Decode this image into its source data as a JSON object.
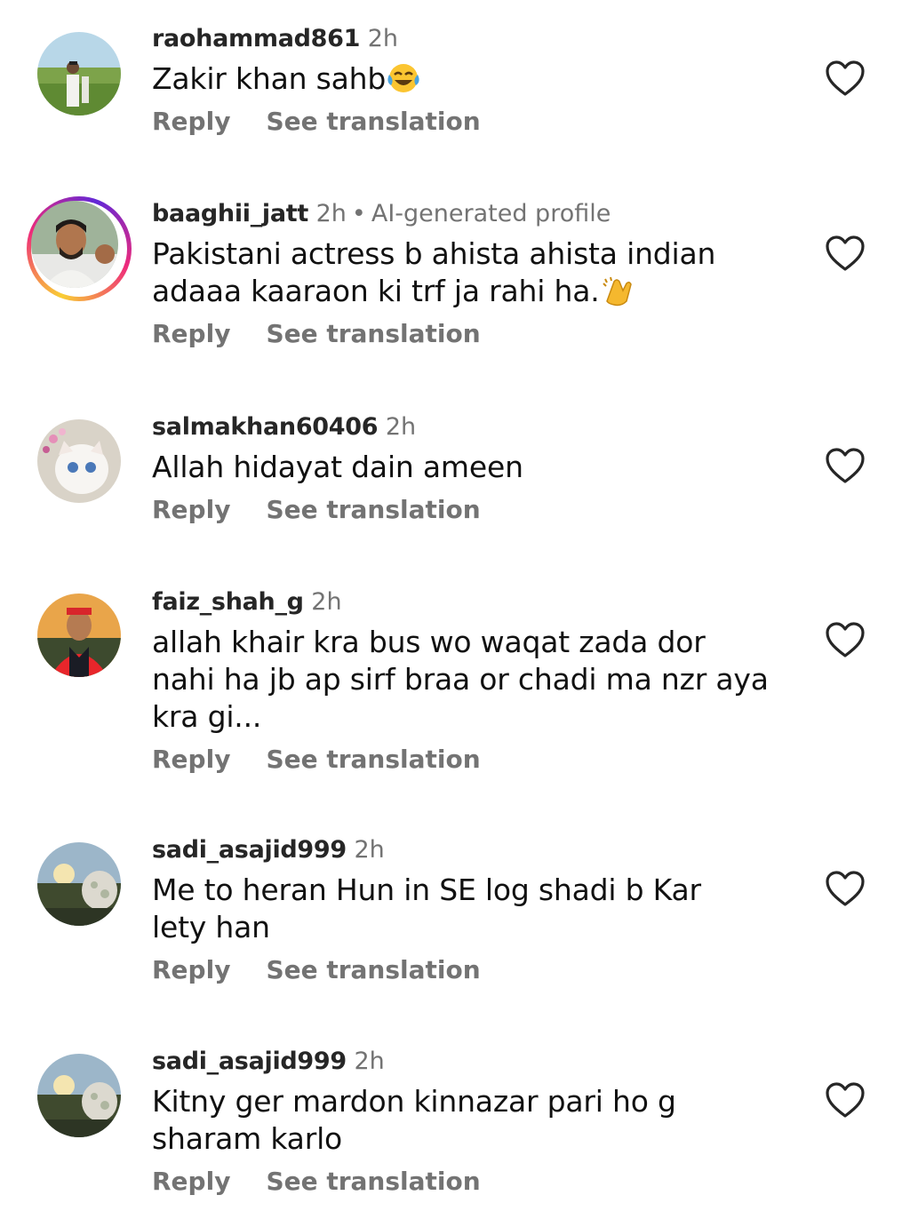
{
  "reply_label": "Reply",
  "translate_label": "See translation",
  "comments": [
    {
      "username": "raohammad861",
      "time": "2h",
      "text": "Zakir khan sahb",
      "emoji": "face-with-tears-of-joy"
    },
    {
      "username": "baaghii_jatt",
      "time": "2h",
      "dot": "•",
      "badge": "AI-generated profile",
      "text_line1": "Pakistani actress b ahista ahista indian",
      "text_line2": "adaaa kaaraon ki trf ja rahi ha.",
      "emoji": "clapping-hands"
    },
    {
      "username": "salmakhan60406",
      "time": "2h",
      "text": "Allah hidayat dain ameen"
    },
    {
      "username": "faiz_shah_g",
      "time": "2h",
      "text_line1": "allah khair kra bus wo waqat zada dor",
      "text_line2": "nahi ha jb ap sirf braa or chadi ma nzr aya",
      "text_line3": "kra gi..."
    },
    {
      "username": "sadi_asajid999",
      "time": "2h",
      "text_line1": "Me to heran Hun in SE log shadi b Kar",
      "text_line2": "lety han"
    },
    {
      "username": "sadi_asajid999",
      "time": "2h",
      "text_line1": "Kitny ger mardon kinnazar pari ho g",
      "text_line2": "sharam karlo"
    }
  ],
  "colors": {
    "username": "#262626",
    "secondary": "#737373",
    "text": "#111111",
    "story_ring": [
      "#f9ce34",
      "#ee2a7b",
      "#6228d7"
    ]
  },
  "icons": {
    "like": "heart-outline-icon"
  }
}
